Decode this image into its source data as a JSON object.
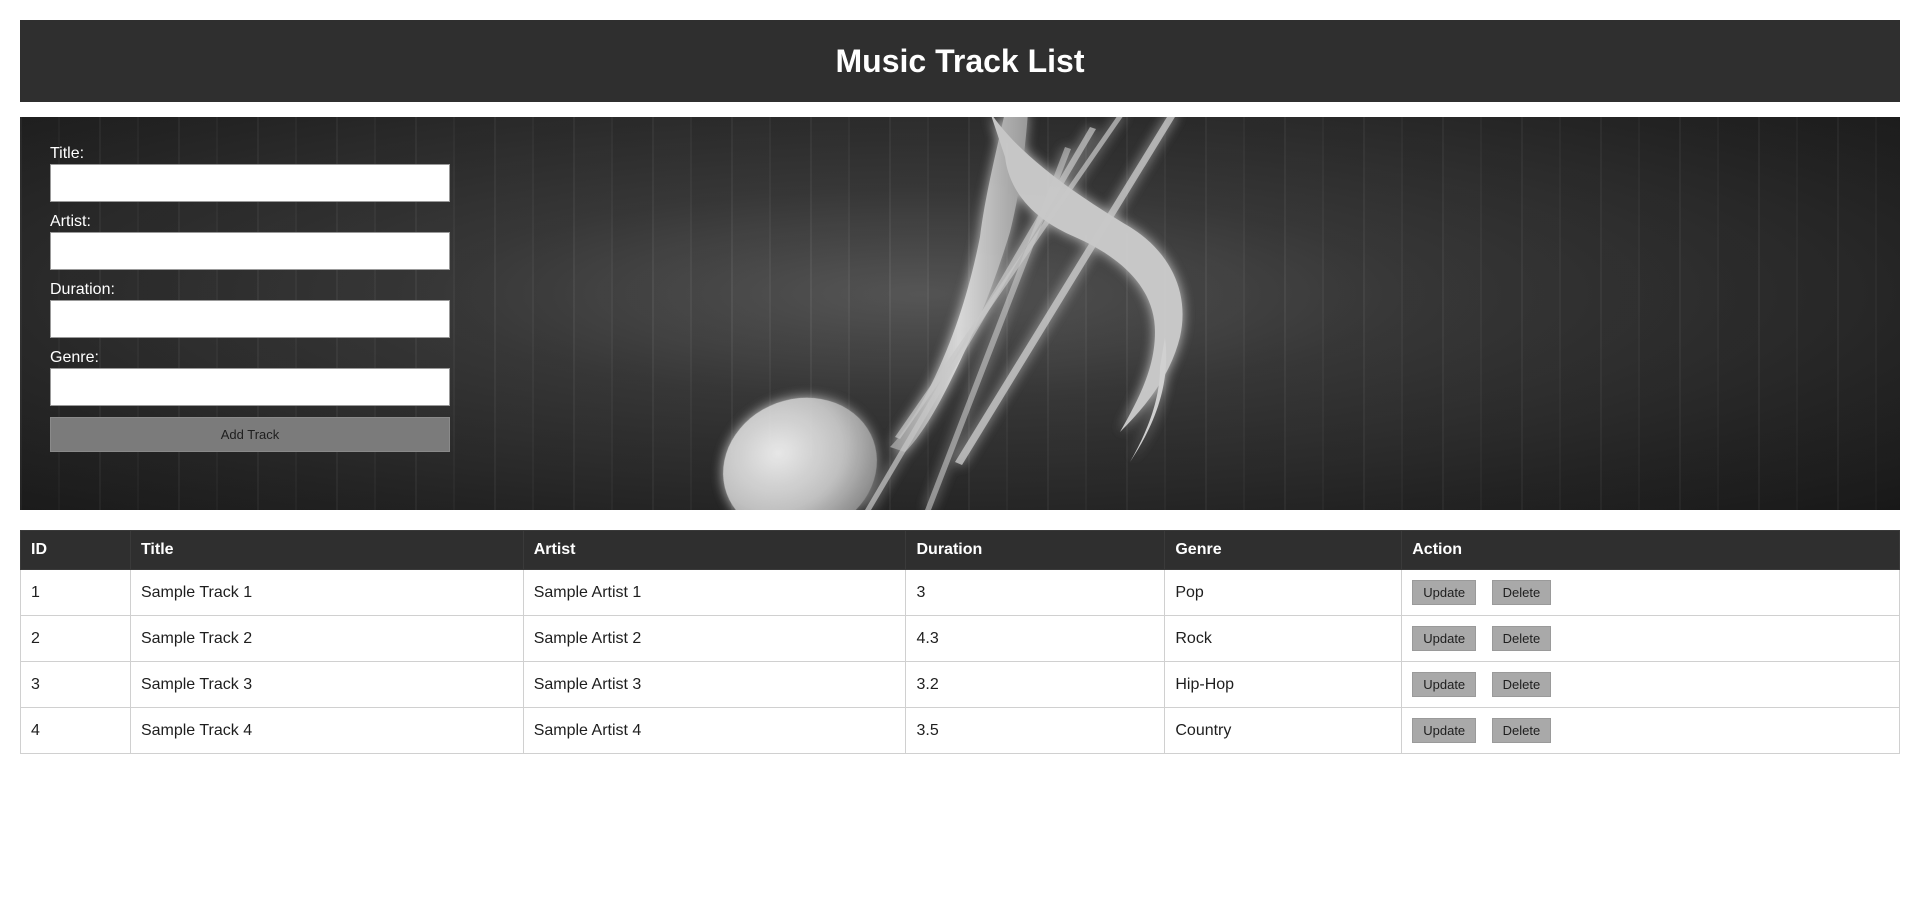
{
  "header": {
    "title": "Music Track List"
  },
  "form": {
    "title_label": "Title:",
    "title_value": "",
    "artist_label": "Artist:",
    "artist_value": "",
    "duration_label": "Duration:",
    "duration_value": "",
    "genre_label": "Genre:",
    "genre_value": "",
    "add_button_label": "Add Track"
  },
  "banner": {
    "image_icon": "music-note-icon"
  },
  "table": {
    "headers": [
      "ID",
      "Title",
      "Artist",
      "Duration",
      "Genre",
      "Action"
    ],
    "rows": [
      {
        "id": "1",
        "title": "Sample Track 1",
        "artist": "Sample Artist 1",
        "duration": "3",
        "genre": "Pop",
        "update_label": "Update",
        "delete_label": "Delete"
      },
      {
        "id": "2",
        "title": "Sample Track 2",
        "artist": "Sample Artist 2",
        "duration": "4.3",
        "genre": "Rock",
        "update_label": "Update",
        "delete_label": "Delete"
      },
      {
        "id": "3",
        "title": "Sample Track 3",
        "artist": "Sample Artist 3",
        "duration": "3.2",
        "genre": "Hip-Hop",
        "update_label": "Update",
        "delete_label": "Delete"
      },
      {
        "id": "4",
        "title": "Sample Track 4",
        "artist": "Sample Artist 4",
        "duration": "3.5",
        "genre": "Country",
        "update_label": "Update",
        "delete_label": "Delete"
      }
    ]
  },
  "colors": {
    "header_bg": "#2f2f2f",
    "button_gray": "#a9a9a9",
    "add_button": "#7b7b7b"
  }
}
